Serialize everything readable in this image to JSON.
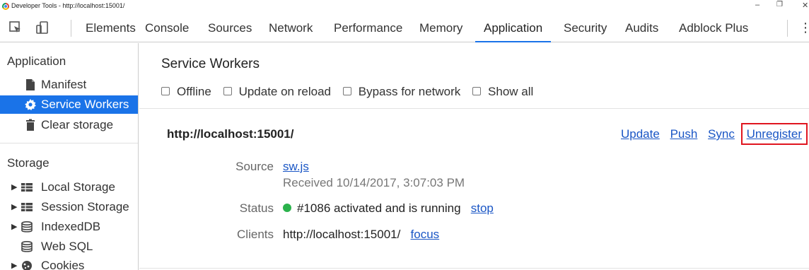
{
  "window": {
    "title": "Developer Tools - http://localhost:15001/",
    "minimize": "–",
    "restore": "❐",
    "close": "✕"
  },
  "tabs": [
    "Elements",
    "Console",
    "Sources",
    "Network",
    "Performance",
    "Memory",
    "Application",
    "Security",
    "Audits",
    "Adblock Plus"
  ],
  "active_tab": "Application",
  "sidebar": {
    "application_title": "Application",
    "app_items": [
      {
        "label": "Manifest",
        "icon": "document-icon"
      },
      {
        "label": "Service Workers",
        "icon": "gear-icon",
        "selected": true
      },
      {
        "label": "Clear storage",
        "icon": "trash-icon"
      }
    ],
    "storage_title": "Storage",
    "storage_items": [
      {
        "label": "Local Storage",
        "icon": "grid-icon",
        "expandable": true
      },
      {
        "label": "Session Storage",
        "icon": "grid-icon",
        "expandable": true
      },
      {
        "label": "IndexedDB",
        "icon": "database-icon",
        "expandable": true
      },
      {
        "label": "Web SQL",
        "icon": "database-icon",
        "expandable": false
      },
      {
        "label": "Cookies",
        "icon": "cookie-icon",
        "expandable": true
      }
    ]
  },
  "main": {
    "title": "Service Workers",
    "options": [
      {
        "label": "Offline",
        "checked": false
      },
      {
        "label": "Update on reload",
        "checked": false
      },
      {
        "label": "Bypass for network",
        "checked": false
      },
      {
        "label": "Show all",
        "checked": false
      }
    ],
    "origin": "http://localhost:15001/",
    "actions": [
      "Update",
      "Push",
      "Sync",
      "Unregister"
    ],
    "highlighted_action": "Unregister",
    "source_label": "Source",
    "source_file": "sw.js",
    "received": "Received 10/14/2017, 3:07:03 PM",
    "status_label": "Status",
    "status_text": "#1086 activated and is running",
    "status_action": "stop",
    "clients_label": "Clients",
    "client_url": "http://localhost:15001/",
    "client_action": "focus"
  },
  "colors": {
    "accent": "#1a73e8",
    "link": "#1a56c5",
    "status_green": "#2bb24c",
    "highlight_box": "#e0151f"
  }
}
